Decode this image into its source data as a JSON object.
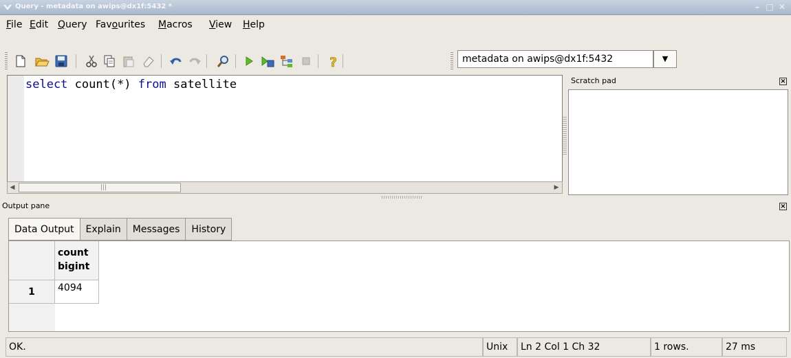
{
  "window": {
    "title": "Query - metadata on awips@dx1f:5432 *",
    "controls": [
      "–",
      "□",
      "✕"
    ]
  },
  "menu": {
    "items": [
      {
        "pre": "",
        "ul": "F",
        "post": "ile"
      },
      {
        "pre": "",
        "ul": "E",
        "post": "dit"
      },
      {
        "pre": "",
        "ul": "Q",
        "post": "uery"
      },
      {
        "pre": "Fav",
        "ul": "o",
        "post": "urites"
      },
      {
        "pre": "",
        "ul": "M",
        "post": "acros"
      },
      {
        "pre": "",
        "ul": "V",
        "post": "iew"
      },
      {
        "pre": "",
        "ul": "H",
        "post": "elp"
      }
    ]
  },
  "toolbar": {
    "icons": [
      "new-file-icon",
      "open-folder-icon",
      "save-icon",
      "cut-icon",
      "copy-icon",
      "paste-icon",
      "clear-icon",
      "undo-icon",
      "redo-icon",
      "find-icon",
      "execute-icon",
      "execute-to-file-icon",
      "explain-icon",
      "cancel-icon",
      "help-icon"
    ],
    "connection": "metadata on awips@dx1f:5432"
  },
  "editor": {
    "sql": {
      "kw1": "select",
      "mid": " count(*) ",
      "kw2": "from",
      "tail": " satellite"
    },
    "scroll_marker": "|||"
  },
  "scratch_pad": {
    "label": "Scratch pad"
  },
  "output": {
    "label": "Output pane",
    "tabs": [
      "Data Output",
      "Explain",
      "Messages",
      "History"
    ],
    "columns": [
      {
        "name": "count",
        "type": "bigint"
      }
    ],
    "rows": [
      {
        "num": "1",
        "values": [
          "4094"
        ]
      }
    ]
  },
  "status": {
    "message": "OK.",
    "line_ending": "Unix",
    "position": "Ln 2 Col 1 Ch 32",
    "rows": "1 rows.",
    "time": "27 ms"
  }
}
